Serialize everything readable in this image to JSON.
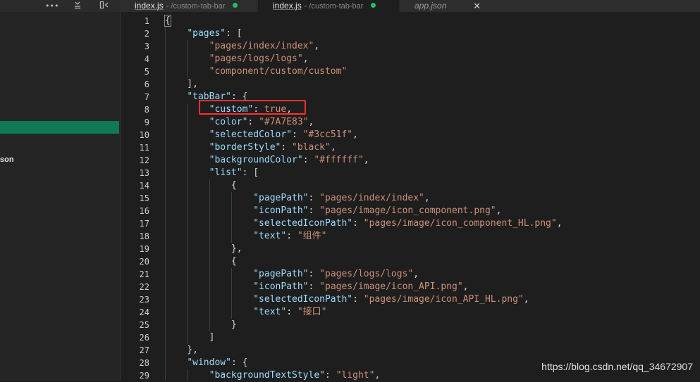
{
  "sidebar": {
    "toolbar": {
      "more_icon": "more-horizontal-icon",
      "collapse_icon": "collapse-all-icon",
      "split_icon": "split-editor-icon"
    },
    "partial_label": "son"
  },
  "tabs": [
    {
      "name": "index.js",
      "path": "- /custom-tab-bar",
      "modified": true
    },
    {
      "name": "index.js",
      "path": "- /custom-tab-bar",
      "modified": true
    },
    {
      "name": "app.json",
      "close": "✕"
    }
  ],
  "editor": {
    "line_numbers": [
      "1",
      "2",
      "3",
      "4",
      "5",
      "6",
      "7",
      "8",
      "9",
      "10",
      "11",
      "12",
      "13",
      "14",
      "15",
      "16",
      "17",
      "18",
      "19",
      "20",
      "21",
      "22",
      "23",
      "24",
      "25",
      "26",
      "27",
      "28",
      "29"
    ],
    "lines": [
      [
        {
          "t": "b",
          "v": "{"
        }
      ],
      [
        {
          "t": "p",
          "v": "    "
        },
        {
          "t": "k",
          "v": "\"pages\""
        },
        {
          "t": "p",
          "v": ": ["
        }
      ],
      [
        {
          "t": "p",
          "v": "        "
        },
        {
          "t": "s",
          "v": "\"pages/index/index\""
        },
        {
          "t": "p",
          "v": ","
        }
      ],
      [
        {
          "t": "p",
          "v": "        "
        },
        {
          "t": "s",
          "v": "\"pages/logs/logs\""
        },
        {
          "t": "p",
          "v": ","
        }
      ],
      [
        {
          "t": "p",
          "v": "        "
        },
        {
          "t": "s",
          "v": "\"component/custom/custom\""
        }
      ],
      [
        {
          "t": "p",
          "v": "    ],"
        }
      ],
      [
        {
          "t": "p",
          "v": "    "
        },
        {
          "t": "k",
          "v": "\"tabBar\""
        },
        {
          "t": "p",
          "v": ": {"
        }
      ],
      [
        {
          "t": "p",
          "v": "        "
        },
        {
          "t": "k",
          "v": "\"custom\""
        },
        {
          "t": "p",
          "v": ": "
        },
        {
          "t": "s",
          "v": "true"
        },
        {
          "t": "p",
          "v": ","
        }
      ],
      [
        {
          "t": "p",
          "v": "        "
        },
        {
          "t": "k",
          "v": "\"color\""
        },
        {
          "t": "p",
          "v": ": "
        },
        {
          "t": "s",
          "v": "\"#7A7E83\""
        },
        {
          "t": "p",
          "v": ","
        }
      ],
      [
        {
          "t": "p",
          "v": "        "
        },
        {
          "t": "k",
          "v": "\"selectedColor\""
        },
        {
          "t": "p",
          "v": ": "
        },
        {
          "t": "s",
          "v": "\"#3cc51f\""
        },
        {
          "t": "p",
          "v": ","
        }
      ],
      [
        {
          "t": "p",
          "v": "        "
        },
        {
          "t": "k",
          "v": "\"borderStyle\""
        },
        {
          "t": "p",
          "v": ": "
        },
        {
          "t": "s",
          "v": "\"black\""
        },
        {
          "t": "p",
          "v": ","
        }
      ],
      [
        {
          "t": "p",
          "v": "        "
        },
        {
          "t": "k",
          "v": "\"backgroundColor\""
        },
        {
          "t": "p",
          "v": ": "
        },
        {
          "t": "s",
          "v": "\"#ffffff\""
        },
        {
          "t": "p",
          "v": ","
        }
      ],
      [
        {
          "t": "p",
          "v": "        "
        },
        {
          "t": "k",
          "v": "\"list\""
        },
        {
          "t": "p",
          "v": ": ["
        }
      ],
      [
        {
          "t": "p",
          "v": "            {"
        }
      ],
      [
        {
          "t": "p",
          "v": "                "
        },
        {
          "t": "k",
          "v": "\"pagePath\""
        },
        {
          "t": "p",
          "v": ": "
        },
        {
          "t": "s",
          "v": "\"pages/index/index\""
        },
        {
          "t": "p",
          "v": ","
        }
      ],
      [
        {
          "t": "p",
          "v": "                "
        },
        {
          "t": "k",
          "v": "\"iconPath\""
        },
        {
          "t": "p",
          "v": ": "
        },
        {
          "t": "s",
          "v": "\"pages/image/icon_component.png\""
        },
        {
          "t": "p",
          "v": ","
        }
      ],
      [
        {
          "t": "p",
          "v": "                "
        },
        {
          "t": "k",
          "v": "\"selectedIconPath\""
        },
        {
          "t": "p",
          "v": ": "
        },
        {
          "t": "s",
          "v": "\"pages/image/icon_component_HL.png\""
        },
        {
          "t": "p",
          "v": ","
        }
      ],
      [
        {
          "t": "p",
          "v": "                "
        },
        {
          "t": "k",
          "v": "\"text\""
        },
        {
          "t": "p",
          "v": ": "
        },
        {
          "t": "s",
          "v": "\"组件\""
        }
      ],
      [
        {
          "t": "p",
          "v": "            },"
        }
      ],
      [
        {
          "t": "p",
          "v": "            {"
        }
      ],
      [
        {
          "t": "p",
          "v": "                "
        },
        {
          "t": "k",
          "v": "\"pagePath\""
        },
        {
          "t": "p",
          "v": ": "
        },
        {
          "t": "s",
          "v": "\"pages/logs/logs\""
        },
        {
          "t": "p",
          "v": ","
        }
      ],
      [
        {
          "t": "p",
          "v": "                "
        },
        {
          "t": "k",
          "v": "\"iconPath\""
        },
        {
          "t": "p",
          "v": ": "
        },
        {
          "t": "s",
          "v": "\"pages/image/icon_API.png\""
        },
        {
          "t": "p",
          "v": ","
        }
      ],
      [
        {
          "t": "p",
          "v": "                "
        },
        {
          "t": "k",
          "v": "\"selectedIconPath\""
        },
        {
          "t": "p",
          "v": ": "
        },
        {
          "t": "s",
          "v": "\"pages/image/icon_API_HL.png\""
        },
        {
          "t": "p",
          "v": ","
        }
      ],
      [
        {
          "t": "p",
          "v": "                "
        },
        {
          "t": "k",
          "v": "\"text\""
        },
        {
          "t": "p",
          "v": ": "
        },
        {
          "t": "s",
          "v": "\"接口\""
        }
      ],
      [
        {
          "t": "p",
          "v": "            }"
        }
      ],
      [
        {
          "t": "p",
          "v": "        ]"
        }
      ],
      [
        {
          "t": "p",
          "v": "    },"
        }
      ],
      [
        {
          "t": "p",
          "v": "    "
        },
        {
          "t": "k",
          "v": "\"window\""
        },
        {
          "t": "p",
          "v": ": {"
        }
      ],
      [
        {
          "t": "p",
          "v": "        "
        },
        {
          "t": "k",
          "v": "\"backgroundTextStyle\""
        },
        {
          "t": "p",
          "v": ": "
        },
        {
          "t": "s",
          "v": "\"light\""
        },
        {
          "t": "p",
          "v": ","
        }
      ]
    ]
  },
  "watermark": "https://blog.csdn.net/qq_34672907",
  "colors": {
    "key": "#9cdcfe",
    "string": "#ce9178",
    "highlight_box": "#ff2d2d",
    "active_row": "#0f7a53",
    "modified_dot": "#23c062"
  }
}
